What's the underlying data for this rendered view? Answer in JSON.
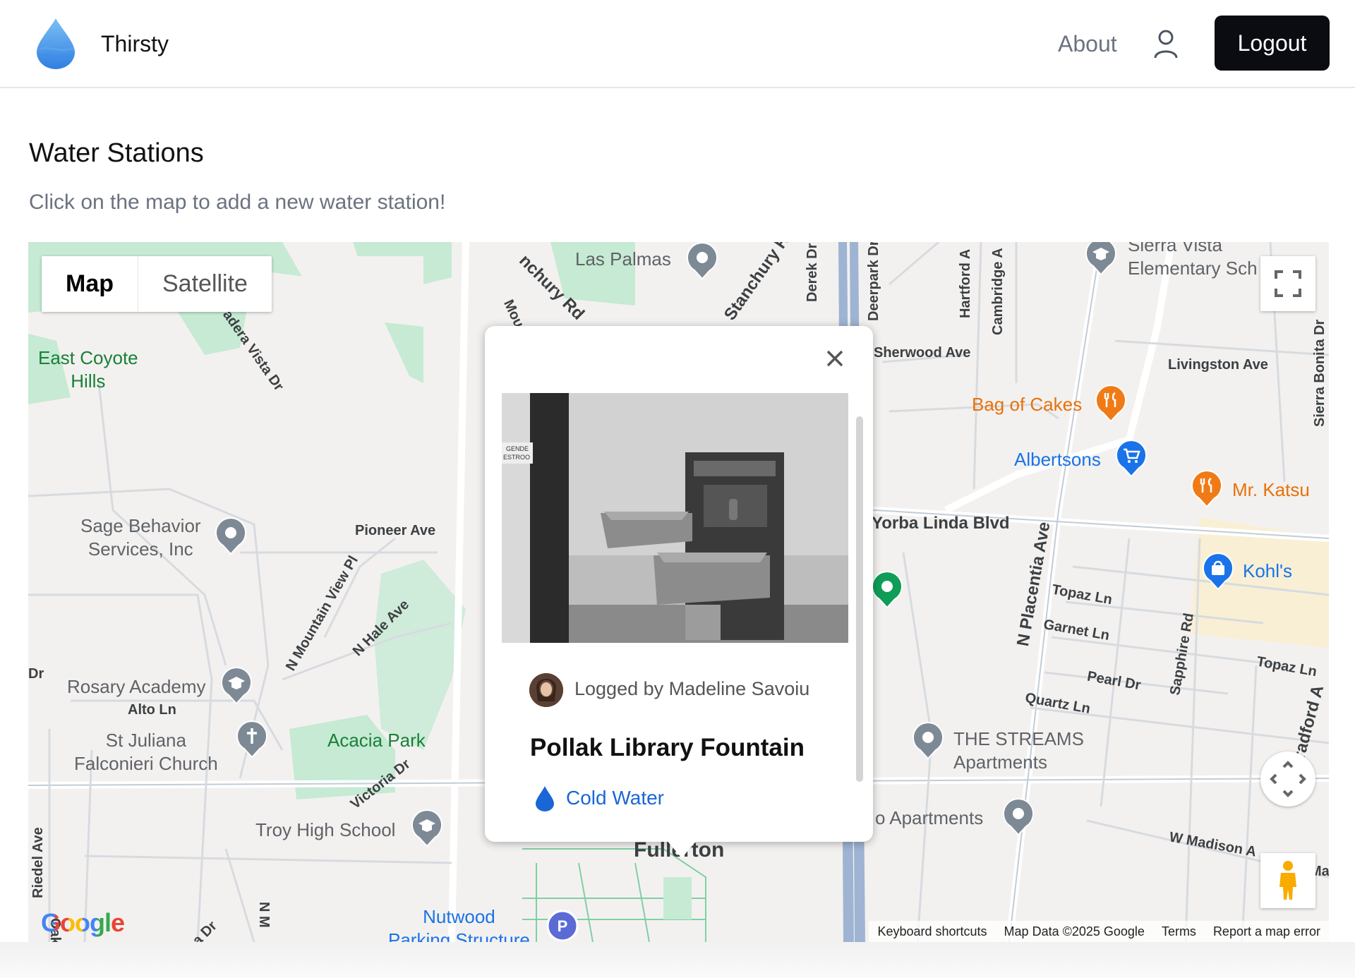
{
  "header": {
    "app_title": "Thirsty",
    "about_label": "About",
    "logout_label": "Logout"
  },
  "main": {
    "title": "Water Stations",
    "subtitle": "Click on the map to add a new water station!"
  },
  "map": {
    "type_controls": {
      "map_label": "Map",
      "satellite_label": "Satellite",
      "active": "Map"
    },
    "labels": {
      "las_palmas": "Las Palmas",
      "sierra_vista": "Sierra Vista\nElementary Sch",
      "east_coyote": "East Coyote\nHills",
      "sherwood": "Sherwood Ave",
      "livingston": "Livingston Ave",
      "bag_of_cakes": "Bag of Cakes",
      "albertsons": "Albertsons",
      "mr_katsu": "Mr. Katsu",
      "sage": "Sage Behavior\nServices, Inc",
      "pioneer": "Pioneer Ave",
      "yorba_linda": "Yorba Linda Blvd",
      "kohls": "Kohl's",
      "topaz": "Topaz Ln",
      "garnet": "Garnet Ln",
      "pearl": "Pearl Dr",
      "quartz": "Quartz Ln",
      "topaz2": "Topaz Ln",
      "rosary": "Rosary Academy",
      "alto": "Alto Ln",
      "st_juliana": "St Juliana\nFalconieri Church",
      "acacia": "Acacia Park",
      "streams": "THE STREAMS\nApartments",
      "o_apartments": "o Apartments",
      "troy": "Troy High School",
      "fullerton": "Fullerton",
      "madison": "W Madison A",
      "nutwood": "Nutwood\nParking Structure",
      "mountain_view": "N Mountain View Pl",
      "hale": "N Hale Ave",
      "victoria": "Victoria Dr",
      "placentia": "N Placentia Ave",
      "sapphire": "Sapphire Rd",
      "bradford": "Bradford A",
      "sierra_bonita": "Sierra Bonita Dr",
      "hartford": "Hartford A",
      "cambridge": "Cambridge A",
      "deerpark": "Deerpark Dr",
      "derek": "Derek Dr",
      "stanchury": "Stanchury Rd",
      "anchury": "nchury Rd",
      "moun": "Moun",
      "madera": "adera Vista Dr",
      "riedel": "Riedel Ave",
      "oakdale": "Oakdale A",
      "dr_left": "Dr",
      "ma": "Ma",
      "n_m": "N M",
      "a_dr": "a Dr"
    },
    "attribution": {
      "keyboard": "Keyboard shortcuts",
      "data": "Map Data ©2025 Google",
      "terms": "Terms",
      "report": "Report a map error"
    },
    "google_logo": "Google",
    "colors": {
      "park": "#b7e4c7",
      "road": "#ffffff",
      "highway": "#9eb4d2",
      "pin_gray": "#7d8a96",
      "pin_orange": "#f07b16",
      "pin_blue": "#1a73e8",
      "pin_green": "#0f9d58"
    }
  },
  "infowindow": {
    "logged_by": "Logged by Madeline Savoiu",
    "station_name": "Pollak Library Fountain",
    "tag_label": "Cold Water",
    "photo_sign_text": "GENDE\nESTROO"
  }
}
